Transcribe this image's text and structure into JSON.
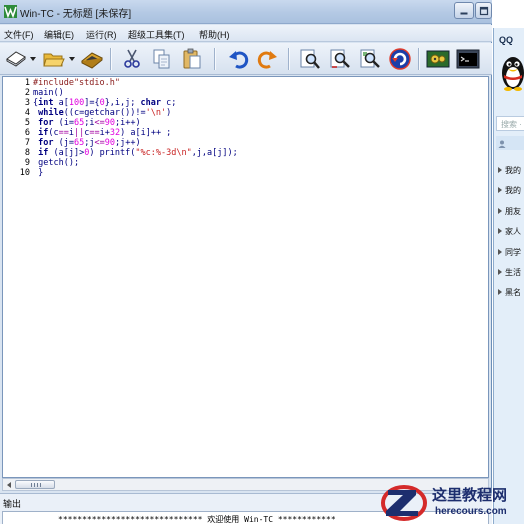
{
  "window": {
    "title": "Win-TC - 无标题 [未保存]"
  },
  "menu": {
    "items": [
      "文件(F)",
      "编辑(E)",
      "运行(R)",
      "超级工具集(T)",
      "帮助(H)"
    ]
  },
  "toolbar": {
    "icons": [
      "new-file-icon",
      "open-folder-icon",
      "save-icon",
      "cut-icon",
      "copy-icon",
      "paste-icon",
      "undo-icon",
      "redo-icon",
      "find-icon",
      "find-next-icon",
      "replace-icon",
      "refresh-icon",
      "compile-icon",
      "run-console-icon"
    ]
  },
  "editor": {
    "line_numbers": [
      "1",
      "2",
      "3",
      "4",
      "5",
      "6",
      "7",
      "8",
      "9",
      "10"
    ],
    "lines": [
      "#include\"stdio.h\"",
      "main()",
      "{int a[100]={0},i,j; char c;",
      " while((c=getchar())!='\\n')",
      " for (i=65;i<=90;i++)",
      " if(c==i||c==i+32) a[i]++ ;",
      " for (j=65;j<=90;j++)",
      " if (a[j]>0) printf(\"%c:%-3d\\n\",j,a[j]);",
      " getch();",
      " }"
    ],
    "scroll_left": "◂",
    "scroll_grip": "III"
  },
  "output": {
    "title": "输出",
    "message": "****************************** 欢迎使用 Win-TC ************"
  },
  "qq_panel": {
    "title": "QQ",
    "search_placeholder": "搜索 · 联系",
    "groups": [
      "我的",
      "我的",
      "朋友",
      "家人",
      "同学",
      "生活",
      "黑名"
    ]
  },
  "watermark": {
    "site_name": "这里教程网",
    "url": "herecours.com"
  },
  "colors": {
    "title_bar": "#b4c9e4",
    "keyword": "#000080",
    "string": "#c82020",
    "number": "#e000e0"
  }
}
